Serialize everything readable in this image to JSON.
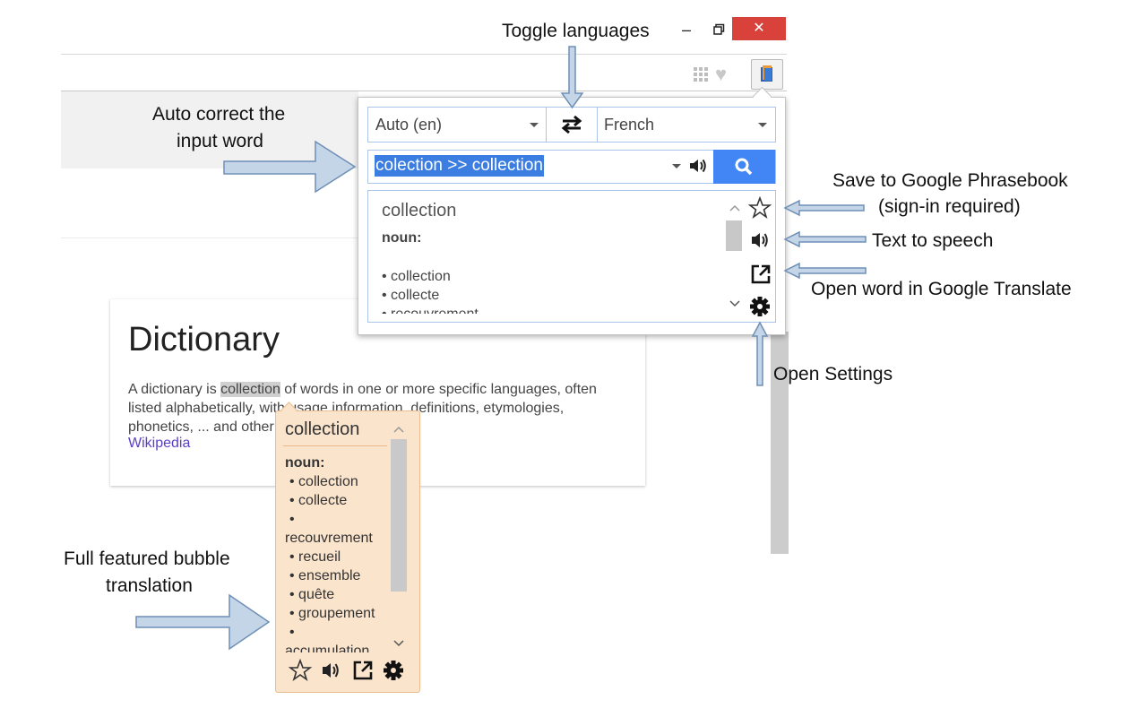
{
  "browser": {
    "window_controls": {
      "minimize": "–",
      "close": "✕"
    },
    "icons": [
      "apps-icon",
      "heart-icon",
      "extension-icon"
    ]
  },
  "dictionary_card": {
    "title": "Dictionary",
    "text_before": "A dictionary is ",
    "highlighted_word": "collection",
    "text_after": " of words in one or more specific languages, often listed alphabetically, with usage information, definitions, etymologies, phonetics, ... and other information; …",
    "source_link": "Wikipedia"
  },
  "popup": {
    "source_language": "Auto (en)",
    "target_language": "French",
    "input_value": "colection >> collection",
    "result": {
      "word": "collection",
      "part_of_speech": "noun:",
      "translations": [
        "collection",
        "collecte",
        "recouvrement"
      ]
    }
  },
  "bubble": {
    "word": "collection",
    "part_of_speech": "noun:",
    "translations": [
      "collection",
      "collecte",
      "recouvrement",
      "recueil",
      "ensemble",
      "quête",
      "groupement",
      "accumulation"
    ]
  },
  "annotations": {
    "toggle_languages": "Toggle languages",
    "auto_correct_line1": "Auto correct the",
    "auto_correct_line2": "input word",
    "save_line1": "Save to Google Phrasebook",
    "save_line2": "(sign-in required)",
    "tts": "Text to speech",
    "open_translate": "Open word in Google Translate",
    "open_settings": "Open Settings",
    "bubble_line1": "Full featured bubble",
    "bubble_line2": "translation"
  },
  "colors": {
    "accent_blue": "#4285f4",
    "selection_blue": "#3b7de0",
    "bubble_bg": "#fbe4cc",
    "close_red": "#d9413b",
    "arrow_fill": "#c5d5e8",
    "arrow_stroke": "#6e8fb5"
  }
}
